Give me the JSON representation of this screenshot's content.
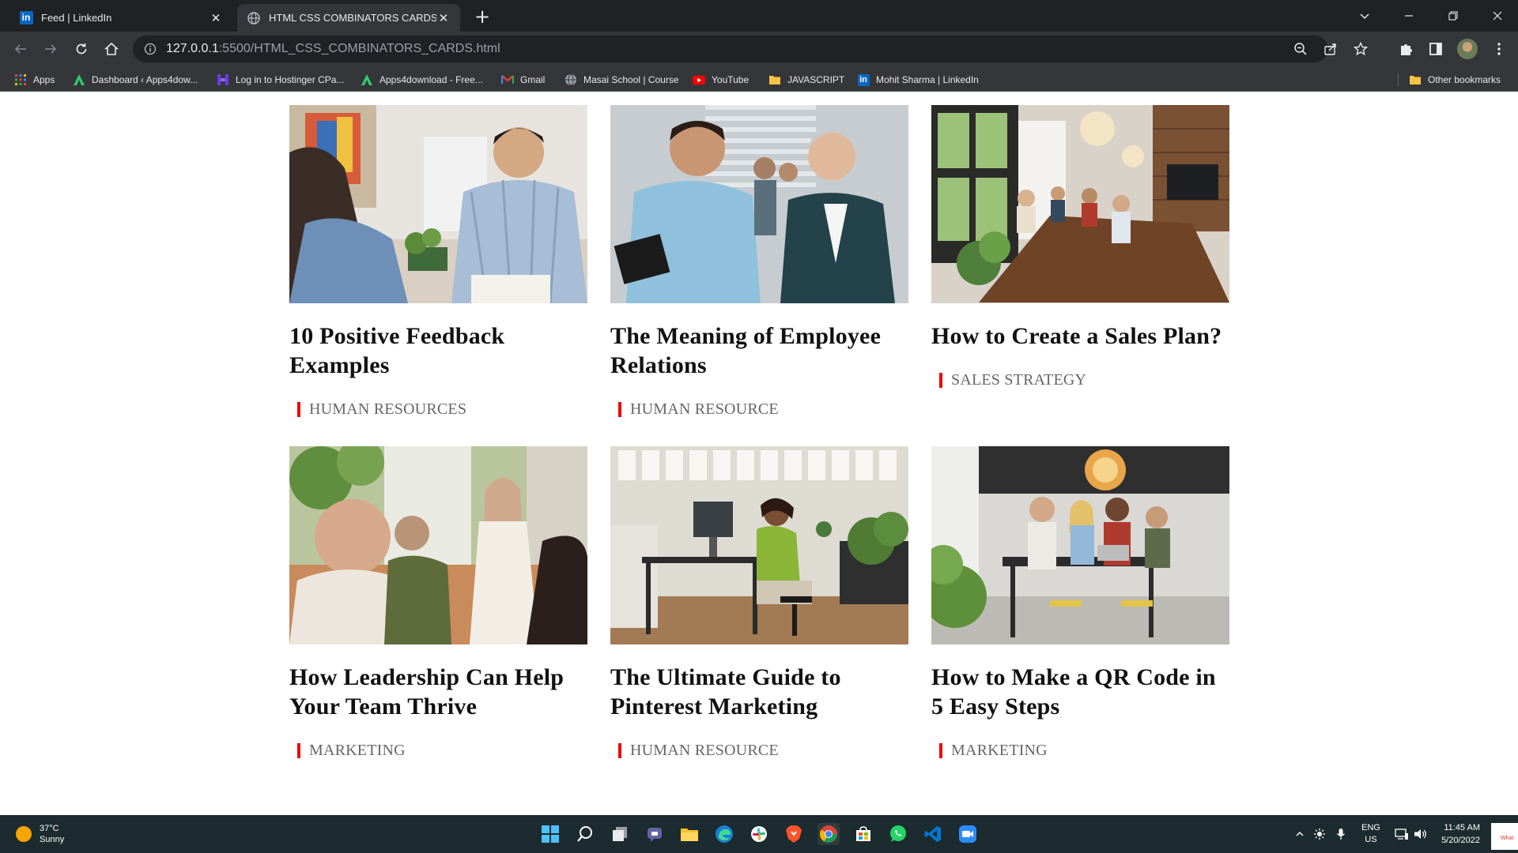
{
  "browser": {
    "tabs": [
      {
        "label": "Feed | LinkedIn",
        "icon": "linkedin-icon",
        "active": false
      },
      {
        "label": "HTML CSS COMBINATORS CARDS",
        "icon": "globe-icon",
        "active": true
      }
    ],
    "url": {
      "host": "127.0.0.1",
      "rest": ":5500/HTML_CSS_COMBINATORS_CARDS.html"
    },
    "bookmarks": [
      {
        "label": "Apps",
        "icon": "apps-grid-icon"
      },
      {
        "label": "Dashboard ‹ Apps4dow...",
        "icon": "apps4download-icon"
      },
      {
        "label": "Log in to Hostinger CPa...",
        "icon": "hostinger-icon"
      },
      {
        "label": "Apps4download - Free...",
        "icon": "apps4download-icon"
      },
      {
        "label": "Gmail",
        "icon": "gmail-icon"
      },
      {
        "label": "Masai School | Course",
        "icon": "globe-icon"
      },
      {
        "label": "YouTube",
        "icon": "youtube-icon"
      },
      {
        "label": "JAVASCRIPT",
        "icon": "folder-icon"
      },
      {
        "label": "Mohit Sharma | LinkedIn",
        "icon": "linkedin-icon"
      }
    ],
    "other_bookmarks": "Other bookmarks"
  },
  "cards": [
    {
      "title": "10 Positive Feedback Examples",
      "category": "HUMAN RESOURCES"
    },
    {
      "title": "The Meaning of Employee Relations",
      "category": "HUMAN RESOURCE"
    },
    {
      "title": "How to Create a Sales Plan?",
      "category": "SALES STRATEGY"
    },
    {
      "title": "How Leadership Can Help Your Team Thrive",
      "category": "MARKETING"
    },
    {
      "title": "The Ultimate Guide to Pinterest Marketing",
      "category": "HUMAN RESOURCE"
    },
    {
      "title": "How to Make a QR Code in 5 Easy Steps",
      "category": "MARKETING"
    }
  ],
  "taskbar": {
    "weather": {
      "temp": "37°C",
      "condition": "Sunny"
    },
    "language": {
      "line1": "ENG",
      "line2": "US"
    },
    "time": "11:45 AM",
    "date": "5/20/2022",
    "notification": "What"
  },
  "colors": {
    "accent_bar": "#ee0000",
    "taskbar": "#1c2b2f",
    "chrome_dark": "#202124"
  }
}
